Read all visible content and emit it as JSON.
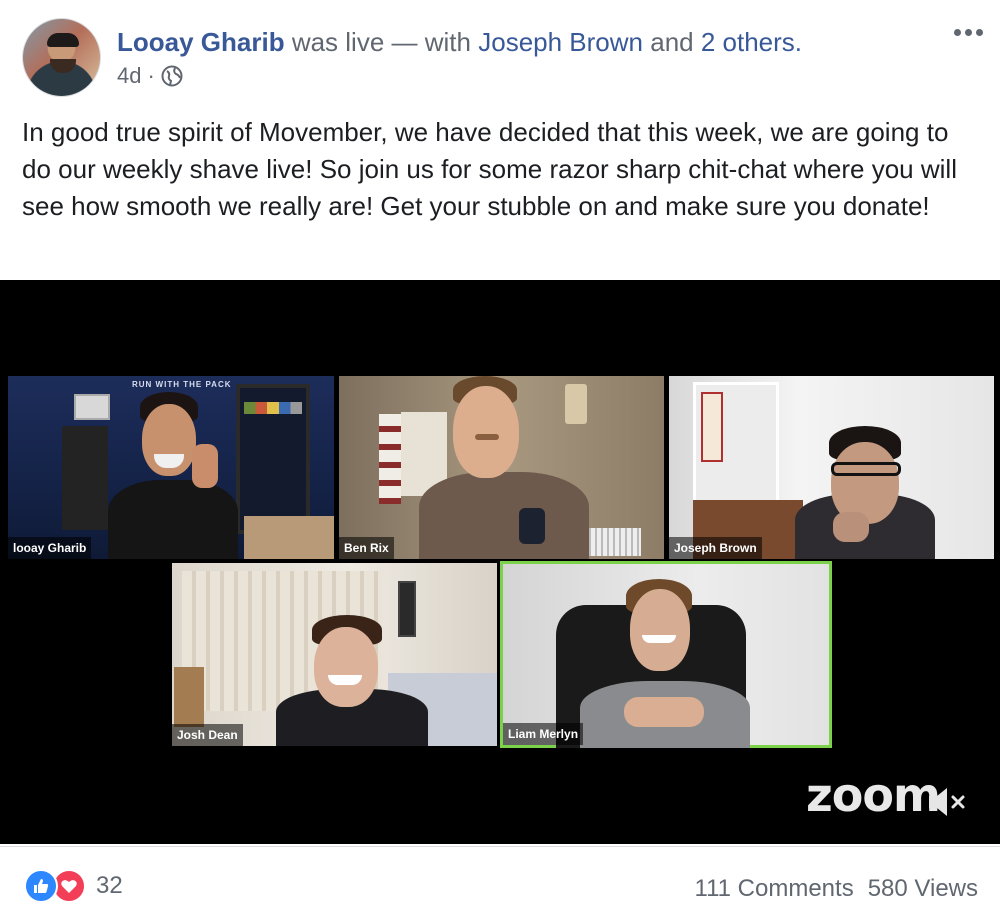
{
  "post": {
    "author": "Looay Gharib",
    "action": "was live —",
    "with_label": "with",
    "tagged": "Joseph Brown",
    "and_label": "and",
    "others": "2 others.",
    "time": "4d",
    "separator": "·",
    "privacy_icon": "globe-icon",
    "menu_icon": "more-options-icon",
    "text": "In good true spirit of Movember, we have decided that this week, we are going to do our weekly shave live! So join us for some razor sharp chit-chat where you will see how smooth we really are! Get your stubble on and make sure you donate!"
  },
  "video": {
    "participants": [
      {
        "name": "looay Gharib"
      },
      {
        "name": "Ben Rix"
      },
      {
        "name": "Joseph Brown"
      },
      {
        "name": "Josh Dean"
      },
      {
        "name": "Liam Merlyn"
      }
    ],
    "poster_text": "RUN WITH THE PACK",
    "logo": "zoom",
    "mute_icon": "muted-speaker-icon",
    "active_speaker_color": "#7bd14a"
  },
  "footer": {
    "reaction_icons": [
      "like-icon",
      "love-icon"
    ],
    "reaction_count": "32",
    "comments": "111 Comments",
    "views": "580 Views"
  },
  "colors": {
    "link": "#385898",
    "text": "#1c1e21",
    "secondary": "#606770",
    "like": "#2d88ff",
    "love": "#f33e58"
  }
}
